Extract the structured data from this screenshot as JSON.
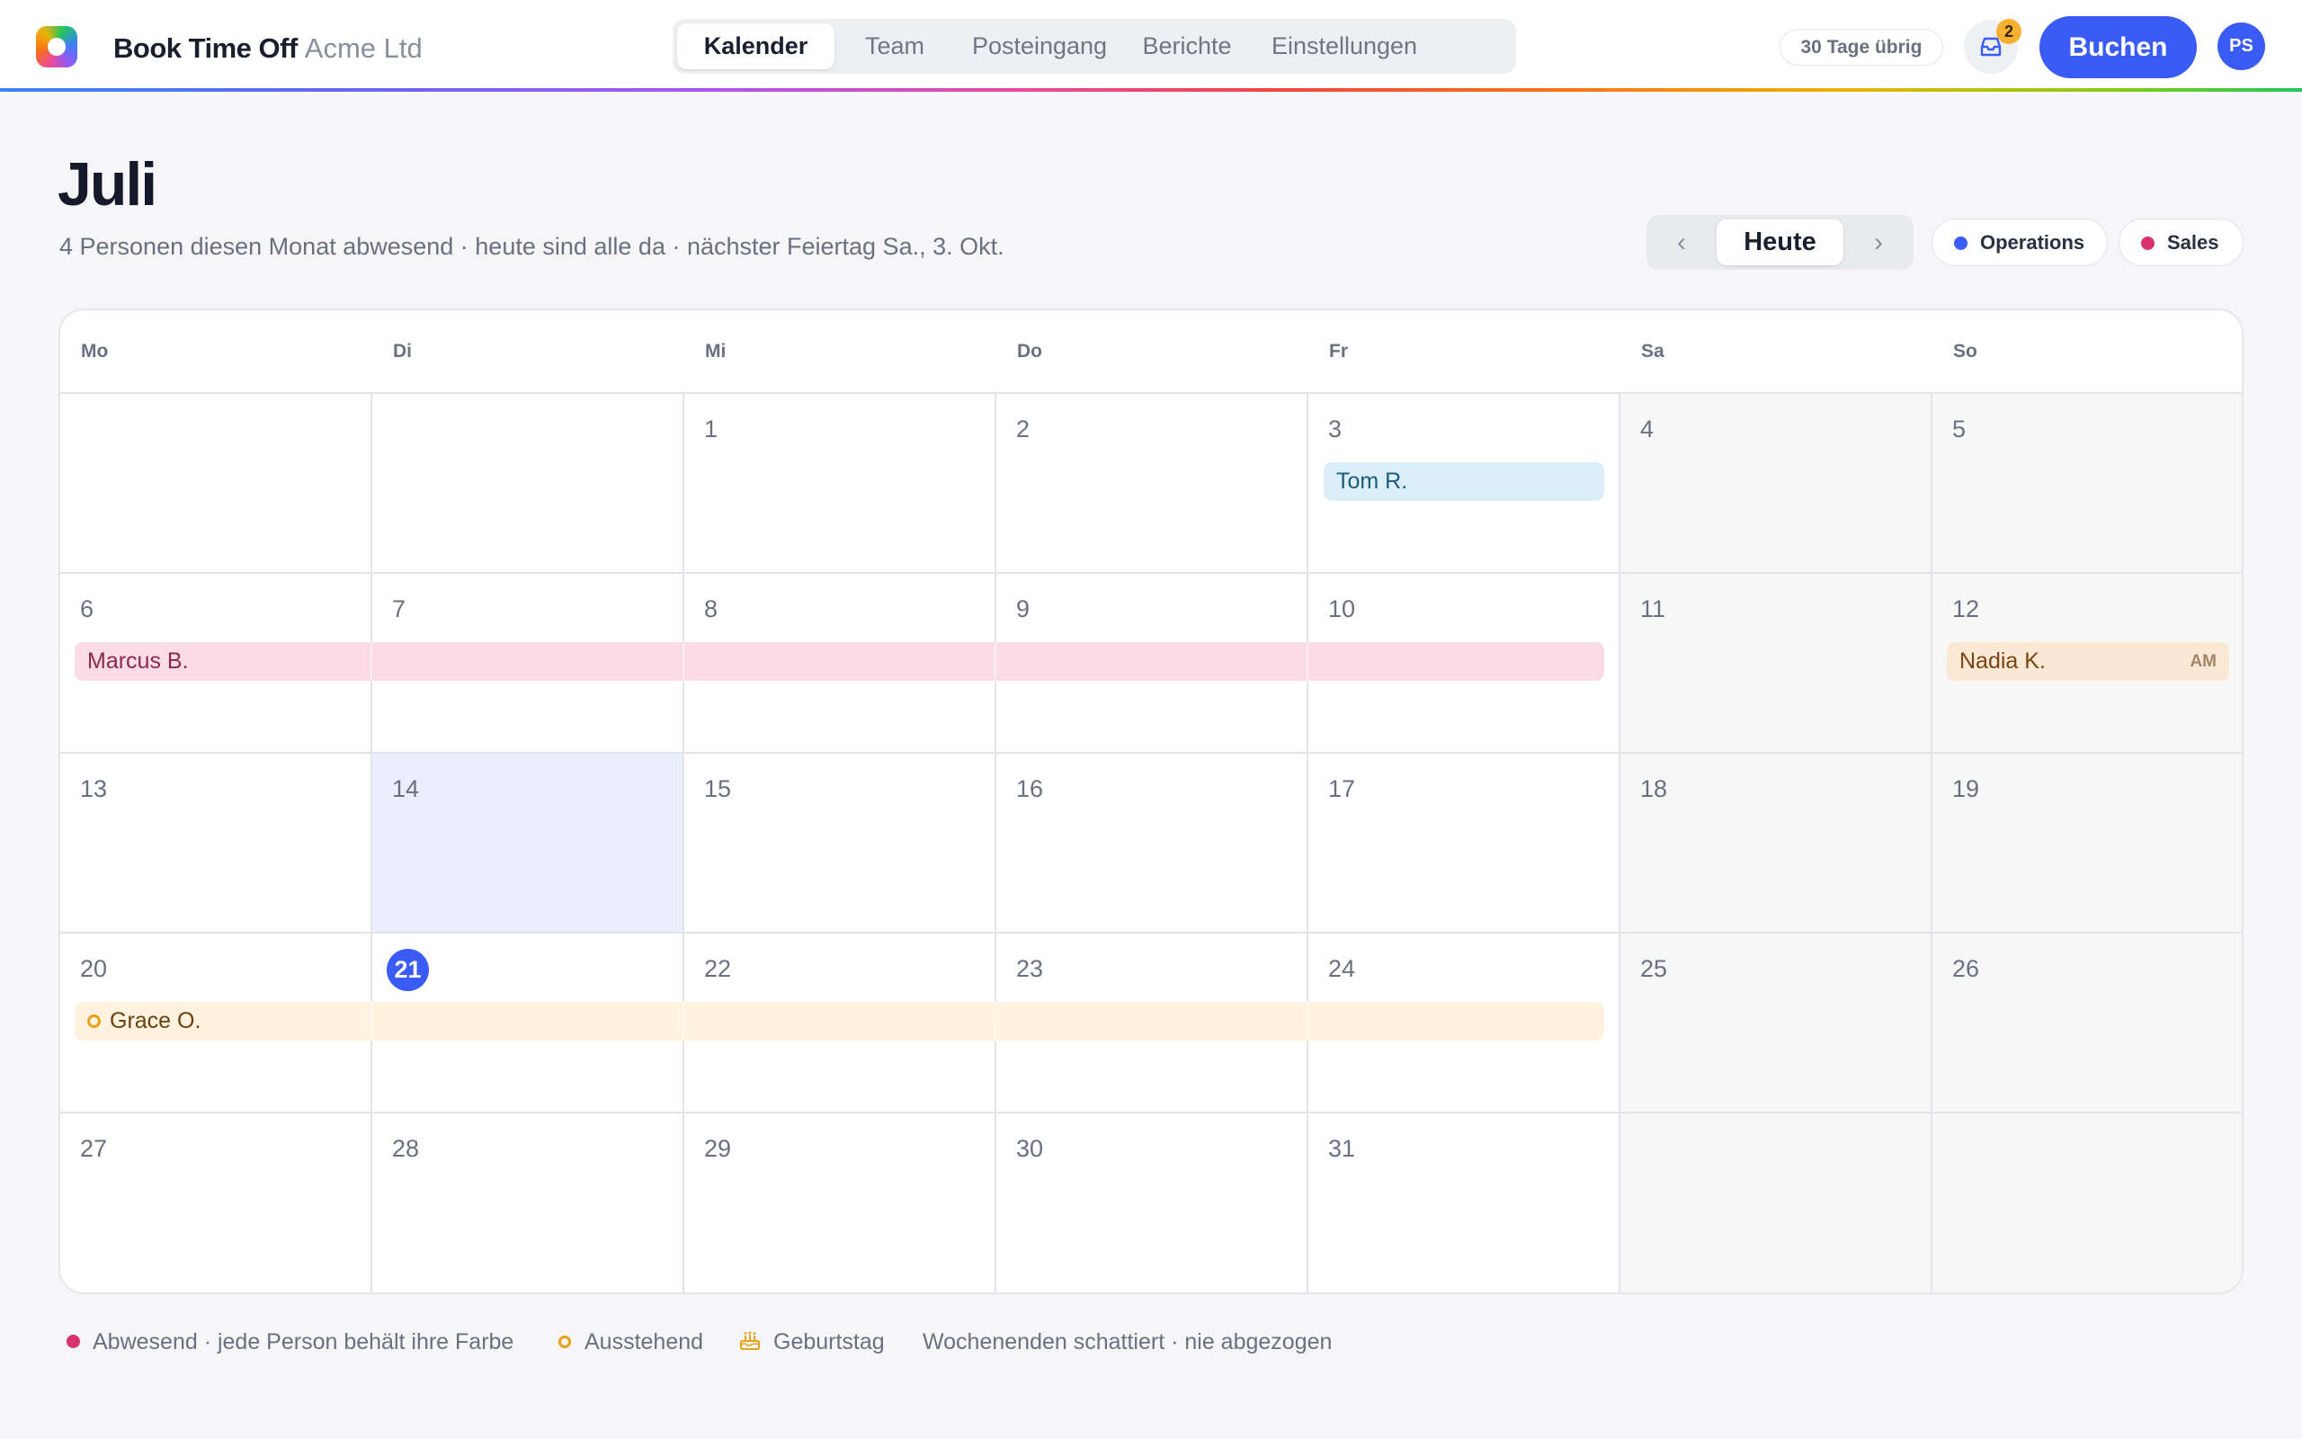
{
  "app": {
    "name": "Book Time Off",
    "org": "Acme Ltd"
  },
  "nav": {
    "tabs": [
      {
        "label": "Kalender",
        "active": true
      },
      {
        "label": "Team",
        "active": false
      },
      {
        "label": "Posteingang",
        "active": false
      },
      {
        "label": "Berichte",
        "active": false
      },
      {
        "label": "Einstellungen",
        "active": false
      }
    ]
  },
  "header_right": {
    "days_left": "30 Tage übrig",
    "inbox_icon": "inbox-icon",
    "inbox_badge": "2",
    "book_label": "Buchen",
    "avatar_initials": "PS"
  },
  "page": {
    "title": "Juli",
    "subtitle": "4 Personen diesen Monat abwesend · heute sind alle da · nächster Feiertag Sa., 3. Okt."
  },
  "controls": {
    "prev": "‹",
    "today": "Heute",
    "next": "›",
    "filters": [
      {
        "label": "Operations",
        "color": "#3b5bf6"
      },
      {
        "label": "Sales",
        "color": "#d8336f"
      }
    ]
  },
  "calendar": {
    "weekdays": [
      "Mo",
      "Di",
      "Mi",
      "Do",
      "Fr",
      "Sa",
      "So"
    ],
    "weeks": [
      [
        "",
        "",
        "1",
        "2",
        "3",
        "4",
        "5"
      ],
      [
        "6",
        "7",
        "8",
        "9",
        "10",
        "11",
        "12"
      ],
      [
        "13",
        "14",
        "15",
        "16",
        "17",
        "18",
        "19"
      ],
      [
        "20",
        "21",
        "22",
        "23",
        "24",
        "25",
        "26"
      ],
      [
        "27",
        "28",
        "29",
        "30",
        "31",
        "",
        ""
      ]
    ],
    "today": "21",
    "highlighted_day": "14",
    "events": [
      {
        "name": "Tom R.",
        "tag": "",
        "pending": false,
        "bg": "#daeffa",
        "fg": "#1e5a7a"
      },
      {
        "name": "Marcus B.",
        "tag": "",
        "pending": false,
        "bg": "#fadbe6",
        "fg": "#8a2a4a"
      },
      {
        "name": "Nadia K.",
        "tag": "AM",
        "pending": false,
        "bg": "#fbe8d4",
        "fg": "#7a4414"
      },
      {
        "name": "Grace O.",
        "tag": "",
        "pending": true,
        "bg": "#fff2de",
        "fg": "#6b3f10"
      }
    ]
  },
  "legend": {
    "absent": "Abwesend · jede Person behält ihre Farbe",
    "pending": "Ausstehend",
    "birthday": "Geburtstag",
    "weekends": "Wochenenden schattiert · nie abgezogen",
    "birthday_icon": "cake-icon"
  }
}
